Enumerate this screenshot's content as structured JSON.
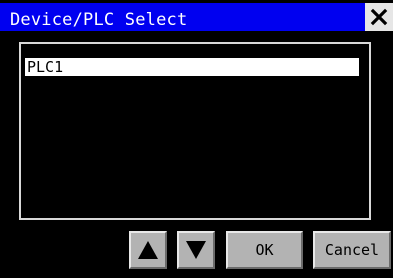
{
  "window": {
    "title": "Device/PLC Select",
    "title_bar_color": "#0000f0",
    "close_icon": "close-icon"
  },
  "list": {
    "items": [
      {
        "label": "PLC1",
        "selected": true
      }
    ]
  },
  "buttons": {
    "up_icon": "triangle-up-icon",
    "down_icon": "triangle-down-icon",
    "ok_label": "OK",
    "cancel_label": "Cancel"
  }
}
